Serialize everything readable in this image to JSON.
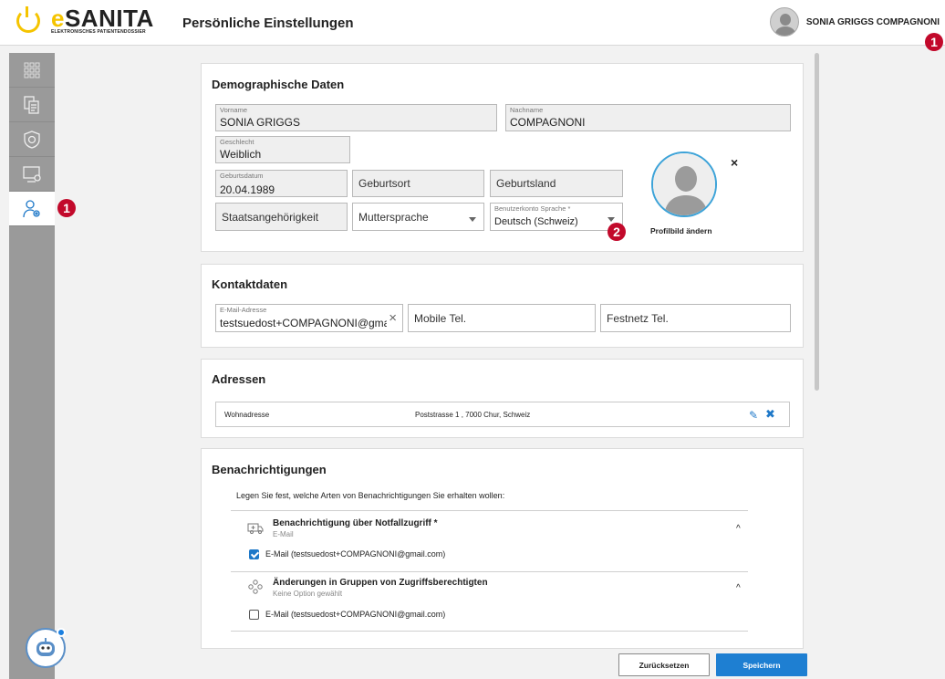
{
  "header": {
    "brand_name_prefix": "e",
    "brand_name": "SANITA",
    "brand_sub": "ELEKTRONISCHES PATIENTENDOSSIER",
    "page_title": "Persönliche Einstellungen",
    "user_name": "SONIA GRIGGS COMPAGNONI",
    "badge_user": "1"
  },
  "sidebar": {
    "items": [
      {
        "icon": "grid-icon"
      },
      {
        "icon": "documents-icon"
      },
      {
        "icon": "shield-access-icon"
      },
      {
        "icon": "device-settings-icon"
      },
      {
        "icon": "user-settings-icon",
        "active": true
      }
    ],
    "badge": "1"
  },
  "demographics": {
    "title": "Demographische Daten",
    "vorname_label": "Vorname",
    "vorname": "SONIA GRIGGS",
    "nachname_label": "Nachname",
    "nachname": "COMPAGNONI",
    "geschlecht_label": "Geschlecht",
    "geschlecht": "Weiblich",
    "geburtsdatum_label": "Geburtsdatum",
    "geburtsdatum": "20.04.1989",
    "geburtsort": "Geburtsort",
    "geburtsland": "Geburtsland",
    "staatsangehoerigkeit": "Staatsangehörigkeit",
    "muttersprache": "Muttersprache",
    "sprache_label": "Benutzerkonto Sprache *",
    "sprache": "Deutsch (Schweiz)",
    "badge_language": "2",
    "photo_close": "×",
    "photo_change": "Profilbild ändern"
  },
  "contact": {
    "title": "Kontaktdaten",
    "email_label": "E-Mail-Adresse",
    "email": "testsuedost+COMPAGNONI@gmail.com",
    "email_clear": "×",
    "mobile": "Mobile Tel.",
    "festnetz": "Festnetz Tel."
  },
  "addresses": {
    "title": "Adressen",
    "rows": [
      {
        "type": "Wohnadresse",
        "value": "Poststrasse 1 , 7000 Chur, Schweiz"
      }
    ],
    "edit_icon": "✎",
    "delete_icon": "✖"
  },
  "notifications": {
    "title": "Benachrichtigungen",
    "intro": "Legen Sie fest, welche Arten von Benachrichtigungen Sie erhalten wollen:",
    "groups": [
      {
        "icon": "ambulance-icon",
        "title": "Benachrichtigung über Notfallzugriff *",
        "subtitle": "E-Mail",
        "option": "E-Mail (testsuedost+COMPAGNONI@gmail.com)",
        "checked": true
      },
      {
        "icon": "group-icon",
        "title": "Änderungen in Gruppen von Zugriffsberechtigten",
        "subtitle": "Keine Option gewählt",
        "option": "E-Mail (testsuedost+COMPAGNONI@gmail.com)",
        "checked": false
      }
    ],
    "chevron": "^"
  },
  "actions": {
    "reset": "Zurücksetzen",
    "save": "Speichern"
  },
  "colors": {
    "accent": "#1e7fd2",
    "brand_yellow": "#f5c400",
    "badge_red": "#c2092b"
  }
}
